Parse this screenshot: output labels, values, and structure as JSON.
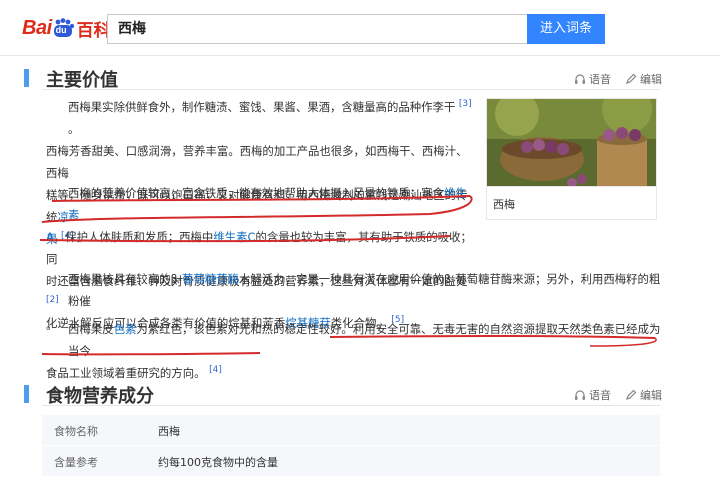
{
  "header": {
    "logo_bai": "Bai",
    "logo_du": "du",
    "logo_baike": "百科",
    "search_value": "西梅",
    "search_button": "进入词条"
  },
  "sections": {
    "main_value": {
      "title": "主要价值",
      "voice": "语音",
      "edit": "编辑"
    },
    "nutrition": {
      "title": "食物营养成分",
      "voice": "语音",
      "edit": "编辑"
    }
  },
  "paragraphs": {
    "p1": {
      "l1": "西梅果实除供鲜食外，制作糖渍、蜜饯、果酱、果酒，含糖量高的品种作李干",
      "ref1": "[3]",
      "l1_end": "。",
      "l2": "西梅芳香甜美、口感润滑，营养丰富。西梅的加工产品也很多，如西梅干、西梅汁、西梅",
      "l3": "糕等，随身携带，既可以饱口福，又对健康有利，用西梅腌制的蜜饯是潮汕地区的传统",
      "l3_link": "凉",
      "l4_link": "果",
      "ref2": "[4]"
    },
    "p2": {
      "l1": "西梅的营养价值较高，富含铁质，能有效地帮助人体摄入足量的铁质；富含",
      "l1_link": "维生素",
      "l2_link": "A",
      "l2": "，保护人体肤质和发质；西梅中",
      "l2_link2": "维生素C",
      "l2b": "的含量也较为丰富，其有助于铁质的吸收；同",
      "l3": "时还富含膳食纤维、钾及对骨质健康极有益处的营养素，这些对人体都有一定的益处",
      "ref": "[2]",
      "l4": "。"
    },
    "p3": {
      "l1a": "西梅果核具有较高的β-",
      "l1_link": "葡萄糖苷酶",
      "l1b": "水解活力，它是一种具有潜在应用价值的β-葡萄糖苷酶来源；另外，利用西梅籽的粗粉催",
      "l2a": "化逆水解反应可以合成各类有价值的烷基和芳香",
      "l2_link": "烷基糖苷",
      "l2b": "类化合物。",
      "ref": "[5]"
    },
    "p4": {
      "l1a": "西梅果皮",
      "l1_link": "色素",
      "l1b": "为紫红色，该色素对光和热的稳定性较好。利用安全可靠、无毒无害的自然资源提取天然类色素已经成为当今",
      "l2": "食品工业领域着重研究的方向。",
      "ref": "[4]"
    }
  },
  "image": {
    "caption": "西梅"
  },
  "nutrition_table": [
    {
      "key": "食物名称",
      "value": "西梅"
    },
    {
      "key": "含量参考",
      "value": "约每100克食物中的含量"
    }
  ],
  "colors": {
    "brand_red": "#de2b1a",
    "button_blue": "#3385ff",
    "section_bar": "#4f9cee",
    "link": "#136ec2",
    "annotation_red": "#d42a2a"
  }
}
